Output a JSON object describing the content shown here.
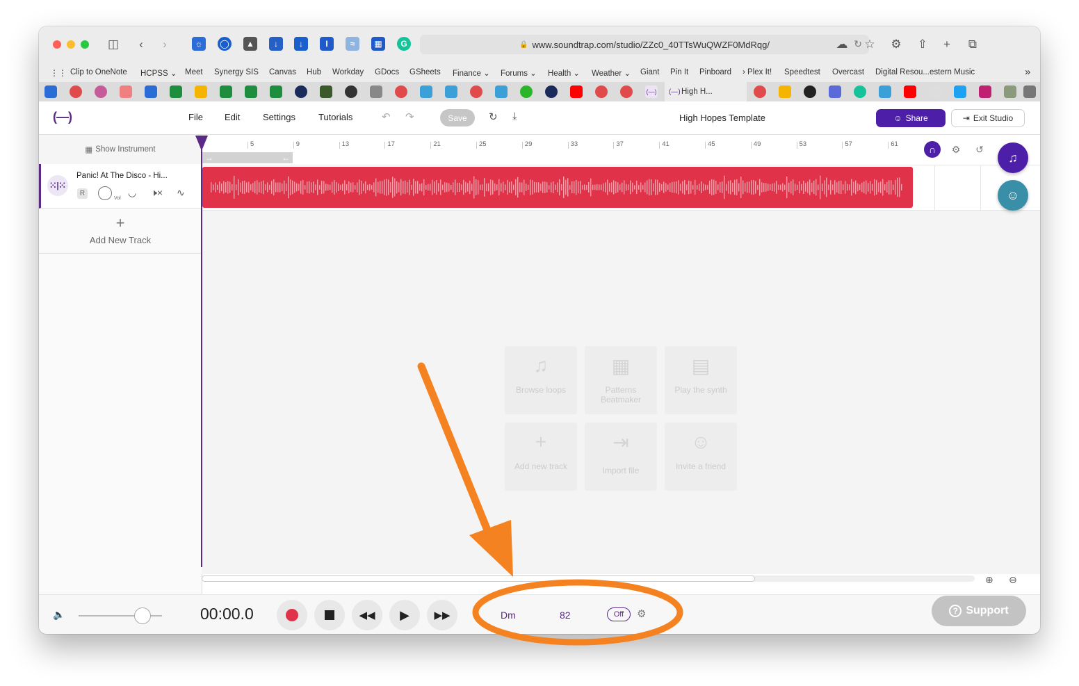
{
  "browser": {
    "url": "www.soundtrap.com/studio/ZZc0_40TTsWuQWZF0MdRqg/",
    "bookmarks": [
      "Clip to OneNote",
      "HCPSS ⌄",
      "Meet",
      "Synergy SIS",
      "Canvas",
      "Hub",
      "Workday",
      "GDocs",
      "GSheets",
      "Finance ⌄",
      "Forums ⌄",
      "Health ⌄",
      "Weather ⌄",
      "Giant",
      "Pin It",
      "Pinboard",
      "› Plex It!",
      "Speedtest",
      "Overcast",
      "Digital Resou...estern Music"
    ],
    "active_tab_title": "High H..."
  },
  "studio": {
    "logo": "(—)",
    "menu": {
      "file": "File",
      "edit": "Edit",
      "settings": "Settings",
      "tutorials": "Tutorials"
    },
    "save_label": "Save",
    "project_title": "High Hopes Template",
    "share_label": "Share",
    "exit_label": "Exit Studio"
  },
  "tracks_panel": {
    "show_instrument": "Show Instrument",
    "track_name": "Panic! At The Disco - Hi...",
    "r_label": "R",
    "vol_label": "Vol",
    "add_track_label": "Add New Track"
  },
  "ruler": {
    "ticks": [
      "5",
      "9",
      "13",
      "17",
      "21",
      "25",
      "29",
      "33",
      "37",
      "41",
      "45",
      "49",
      "53",
      "57",
      "61"
    ]
  },
  "empty_state": {
    "browse_loops": "Browse loops",
    "patterns": "Patterns Beatmaker",
    "synth": "Play the synth",
    "add_track": "Add new track",
    "import": "Import file",
    "invite": "Invite a friend"
  },
  "transport": {
    "time": "00:00.0",
    "key": "Dm",
    "bpm": "82",
    "metronome": "Off",
    "support_label": "Support"
  },
  "colors": {
    "brand": "#5b2a86",
    "clip": "#e0334a",
    "annotation": "#f58220"
  }
}
